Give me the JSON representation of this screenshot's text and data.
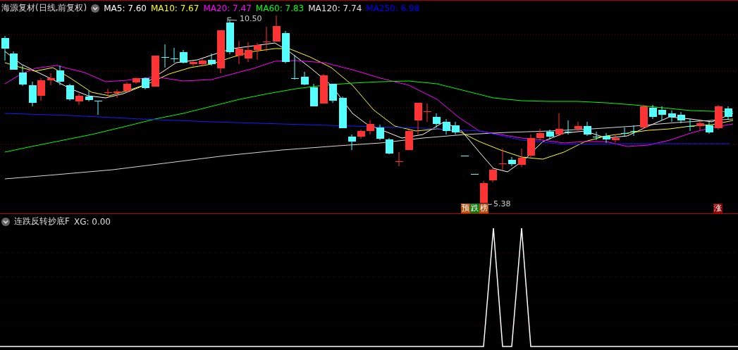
{
  "main_panel": {
    "title": "海源复材(日线,前复权)",
    "moving_averages": [
      {
        "label": "MA5: 7.60",
        "color": "#ffffff"
      },
      {
        "label": "MA10: 7.67",
        "color": "#ffff00"
      },
      {
        "label": "MA20: 7.47",
        "color": "#ff00ff"
      },
      {
        "label": "MA60: 7.83",
        "color": "#00ff00"
      },
      {
        "label": "MA120: 7.74",
        "color": "#e0e0e0"
      },
      {
        "label": "MA250: 6.98",
        "color": "#0000ff"
      }
    ],
    "high_label": "10.50",
    "low_label": "5.38",
    "rank_badge": [
      {
        "text": "预",
        "color": "#b5500f"
      },
      {
        "text": "跌",
        "color": "#0a7a0a"
      },
      {
        "text": "榜",
        "color": "#b5500f"
      }
    ],
    "rise_badge": "涨"
  },
  "indicator_panel": {
    "title": "连跌反转抄底F",
    "reading": "XG: 0.00"
  }
}
